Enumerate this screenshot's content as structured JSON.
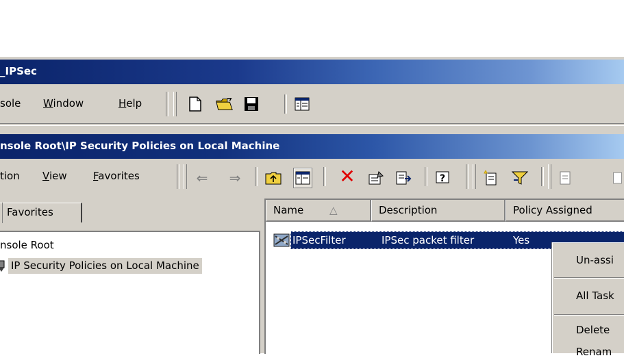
{
  "window": {
    "title": "_IPSec"
  },
  "main_menu": {
    "items": [
      {
        "text": "sole",
        "underline_char": ""
      },
      {
        "text": "Window",
        "underline_char": "W",
        "rest": "indow"
      },
      {
        "text": "Help",
        "underline_char": "H",
        "rest": "elp"
      }
    ]
  },
  "child_window": {
    "title": "nsole Root\\IP Security Policies on Local Machine"
  },
  "child_menu": {
    "action": "tion",
    "view_u": "V",
    "view_rest": "iew",
    "favorites_u": "F",
    "favorites_rest": "avorites"
  },
  "tabs": {
    "favorites": "Favorites"
  },
  "tree": {
    "root": "nsole Root",
    "node": "IP Security Policies on Local Machine"
  },
  "list": {
    "columns": [
      "Name",
      "Description",
      "Policy Assigned"
    ],
    "sort_indicator": "△",
    "rows": [
      {
        "name": "IPSecFilter",
        "description": "IPSec packet filter",
        "assigned": "Yes"
      }
    ]
  },
  "context_menu": {
    "items": [
      "Un-assi",
      "All Task",
      "Delete",
      "Renam"
    ]
  },
  "colors": {
    "title_active": "#0b246a",
    "face": "#d4d0c8",
    "selection": "#0a246a"
  }
}
